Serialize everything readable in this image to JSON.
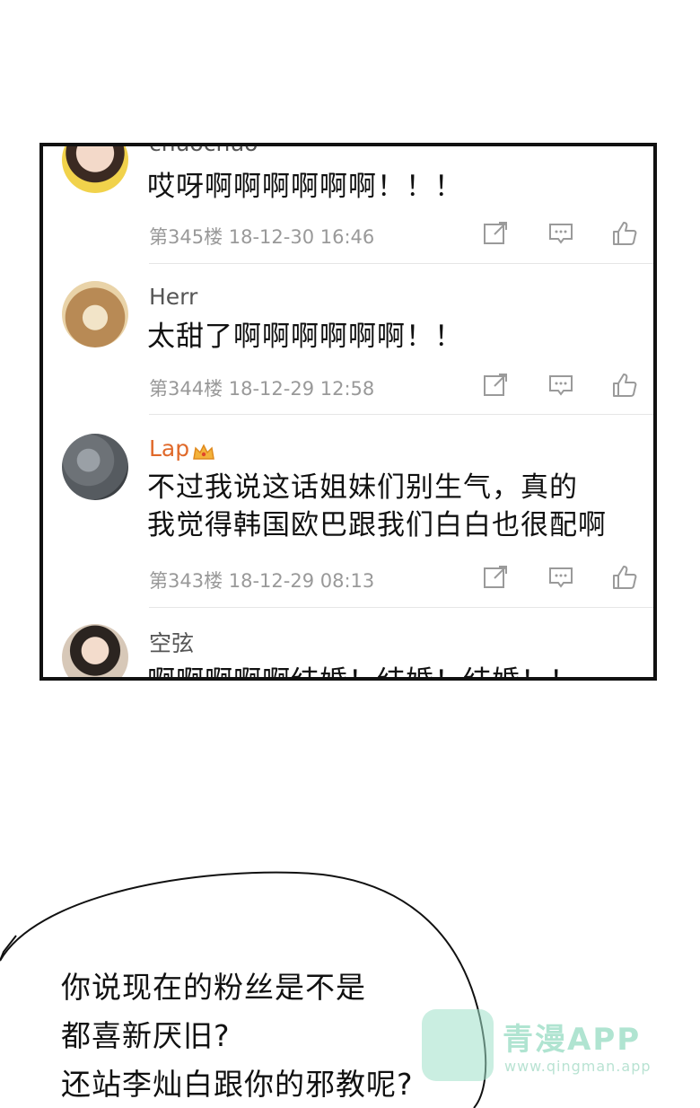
{
  "comments": [
    {
      "username": "chuochuo",
      "text": [
        "哎呀啊啊啊啊啊啊！！！"
      ],
      "meta": "第345楼 18-12-30 16:46"
    },
    {
      "username": "Herr",
      "text": [
        "太甜了啊啊啊啊啊啊！！"
      ],
      "meta": "第344楼 18-12-29 12:58"
    },
    {
      "username": "Lap",
      "text": [
        "不过我说这话姐妹们别生气，真的",
        "我觉得韩国欧巴跟我们白白也很配啊"
      ],
      "meta": "第343楼 18-12-29 08:13"
    },
    {
      "username": "空弦",
      "text": [
        "啊啊啊啊啊结婚！结婚！结婚！！"
      ]
    }
  ],
  "bubble": {
    "lines": [
      "你说现在的粉丝是不是",
      "都喜新厌旧?",
      "还站李灿白跟你的邪教呢?"
    ]
  },
  "watermark": {
    "title": "青漫APP",
    "url": "www.qingman.app"
  }
}
